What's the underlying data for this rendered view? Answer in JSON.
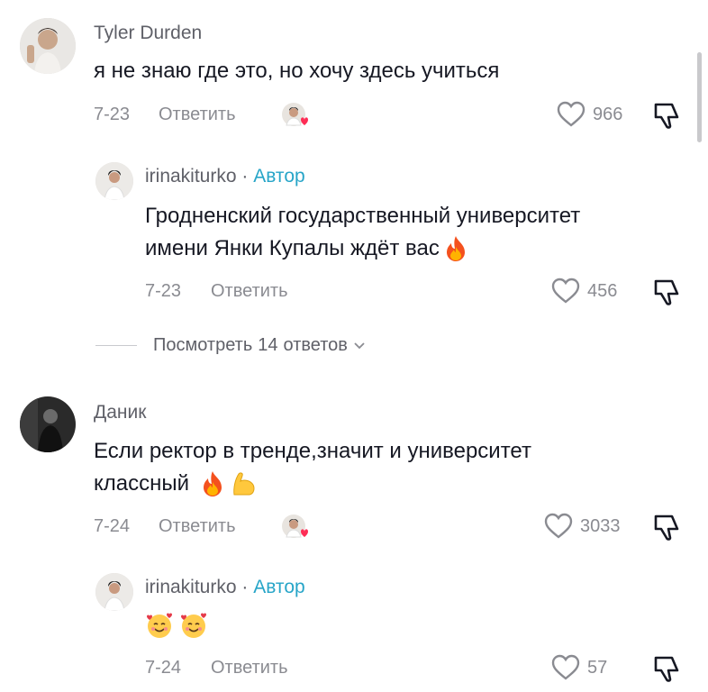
{
  "comments": [
    {
      "author": "Tyler Durden",
      "text": "я не знаю где это, но хочу здесь учиться",
      "date": "7-23",
      "reply_label": "Ответить",
      "likes": "966"
    },
    {
      "author": "irinakiturko",
      "badge": "Автор",
      "separator": "·",
      "text_line1": "Гродненский государственный университет",
      "text_line2": "имени Янки Купалы ждёт вас",
      "date": "7-23",
      "reply_label": "Ответить",
      "likes": "456"
    },
    {
      "view_replies_prefix": "Посмотреть",
      "view_replies_count": "14",
      "view_replies_suffix": "ответов"
    },
    {
      "author": "Даник",
      "text_line1": "Если ректор в тренде,значит и университет",
      "text_line2": "классный",
      "date": "7-24",
      "reply_label": "Ответить",
      "likes": "3033"
    },
    {
      "author": "irinakiturko",
      "badge": "Автор",
      "separator": "·",
      "date": "7-24",
      "reply_label": "Ответить",
      "likes": "57"
    }
  ],
  "icons": {
    "like": "heart-outline-icon",
    "dislike": "thumbs-down-icon",
    "fire": "fire-emoji",
    "muscle": "flexed-biceps-emoji",
    "smiling_hearts": "smiling-face-with-hearts-emoji",
    "chevron": "chevron-down-icon"
  },
  "colors": {
    "author_badge": "#27a5c8",
    "meta": "#8a8b91",
    "text": "#161823"
  }
}
